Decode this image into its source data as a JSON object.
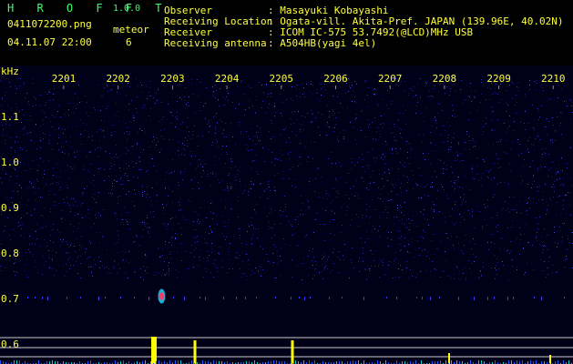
{
  "app": {
    "name": "H R O F F T",
    "version": "1.0.0",
    "filename": "0411072200.png",
    "datetime": "04.11.07 22:00",
    "meteor_label": "meteor",
    "meteor_count": "6"
  },
  "info": [
    {
      "label": "Observer",
      "value": ": Masayuki Kobayashi"
    },
    {
      "label": "Receiving Location",
      "value": ": Ogata-vill. Akita-Pref. JAPAN (139.96E, 40.02N)"
    },
    {
      "label": "Receiver",
      "value": ": ICOM IC-575 53.7492(@LCD)MHz USB"
    },
    {
      "label": "Receiving antenna",
      "value": ": A504HB(yagi 4el)"
    }
  ],
  "axis": {
    "unit": "kHz",
    "x_ticks": [
      "2201",
      "2202",
      "2203",
      "2204",
      "2205",
      "2206",
      "2207",
      "2208",
      "2209",
      "2210"
    ],
    "y_ticks": [
      "1.1",
      "1.0",
      "0.9",
      "0.8",
      "0.7",
      "0.6"
    ]
  },
  "colors": {
    "label_green": "#39ff6a",
    "label_yellow": "#ffff3a",
    "spectrum_bg": "#000018",
    "noise_blue": "#2a2ab0",
    "meteor_red": "#ff3a6a",
    "meteor_cyan": "#22ddff",
    "grid_line": "#cccccc",
    "echo_yellow": "#ffff00"
  },
  "meteors": [
    {
      "time": "2202.8",
      "freq_khz": 0.705
    }
  ]
}
